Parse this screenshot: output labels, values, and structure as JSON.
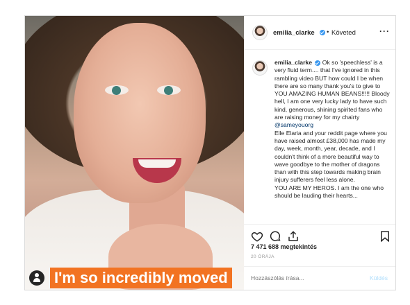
{
  "post": {
    "caption_overlay": "I'm so incredibly moved",
    "header": {
      "username": "emilia_clarke",
      "separator": "•",
      "follow_status": "Követed",
      "more_icon": "more-horizontal-icon"
    },
    "comment": {
      "username": "emilia_clarke",
      "text_part1": " Ok so 'speechless' is a very fluid term.... that I've ignored in this rambling video BUT how could I be when there are so many thank you's to give to YOU AMAZING HUMAN BEANS!!!!! Bloody hell, I am one very lucky lady to have such kind, generous, shining spirited fans who are raising money for my chairty ",
      "mention": "@sameyouorg",
      "text_part2": "Elle Elaria and your reddit page where you have raised almost £38,000 has made my day, week, month, year, decade, and I couldn't think of a more beautiful way to wave goodbye to the mother of dragons than with this step towards making brain injury sufferers feel less alone.",
      "text_part3": "YOU ARE MY HEROS. I am the one who should be lauding their hearts..."
    },
    "likes": "7 471 688 megtekintés",
    "time": "20 ÓRÁJA",
    "add_comment": {
      "placeholder": "Hozzászólás írása...",
      "post_label": "Küldés"
    },
    "colors": {
      "caption_bg": "#f27322",
      "verified": "#3897f0",
      "mention": "#003569",
      "post_disabled": "#b2dffc"
    }
  }
}
